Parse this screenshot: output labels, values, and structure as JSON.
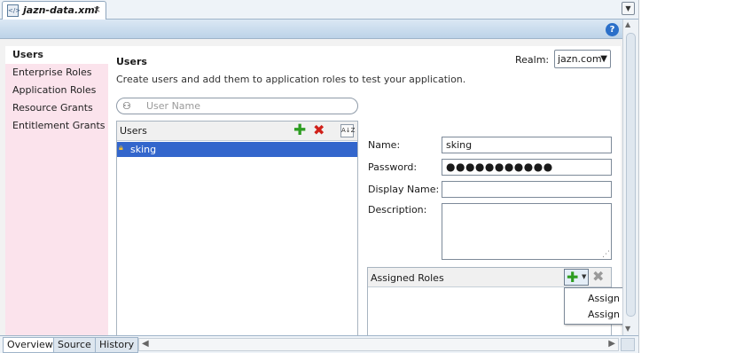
{
  "file_tab": {
    "title": "jazn-data.xml",
    "icon": "xml-file-icon",
    "close": "×"
  },
  "tab_menu_icon": "dropdown-icon",
  "help_icon": "?",
  "sidebar": {
    "items": [
      {
        "label": "Users",
        "selected": true
      },
      {
        "label": "Enterprise Roles",
        "selected": false
      },
      {
        "label": "Application Roles",
        "selected": false
      },
      {
        "label": "Resource Grants",
        "selected": false
      },
      {
        "label": "Entitlement Grants",
        "selected": false
      }
    ]
  },
  "main": {
    "section_title": "Users",
    "description": "Create users and add them to application roles to test your application.",
    "realm_label": "Realm:",
    "realm_value": "jazn.com",
    "search_placeholder": "User Name",
    "users_header": "Users",
    "users": [
      {
        "name": "sking",
        "selected": true
      }
    ]
  },
  "form": {
    "name_label": "Name:",
    "name_value": "sking",
    "password_label": "Password:",
    "password_value": "●●●●●●●●●●●",
    "display_name_label": "Display Name:",
    "display_name_value": "",
    "description_label": "Description:",
    "description_value": ""
  },
  "assigned_roles": {
    "header": "Assigned Roles",
    "menu": [
      "Assign Application Role",
      "Assign Enterprise Role"
    ]
  },
  "bottom_tabs": [
    {
      "label": "Overview",
      "selected": true
    },
    {
      "label": "Source",
      "selected": false
    },
    {
      "label": "History",
      "selected": false
    }
  ],
  "colors": {
    "selection": "#3366cc",
    "nav_bg": "#fbe3ec",
    "header_band": "#bcd3e8",
    "add_green": "#2e9d22",
    "delete_red": "#d0201a"
  }
}
